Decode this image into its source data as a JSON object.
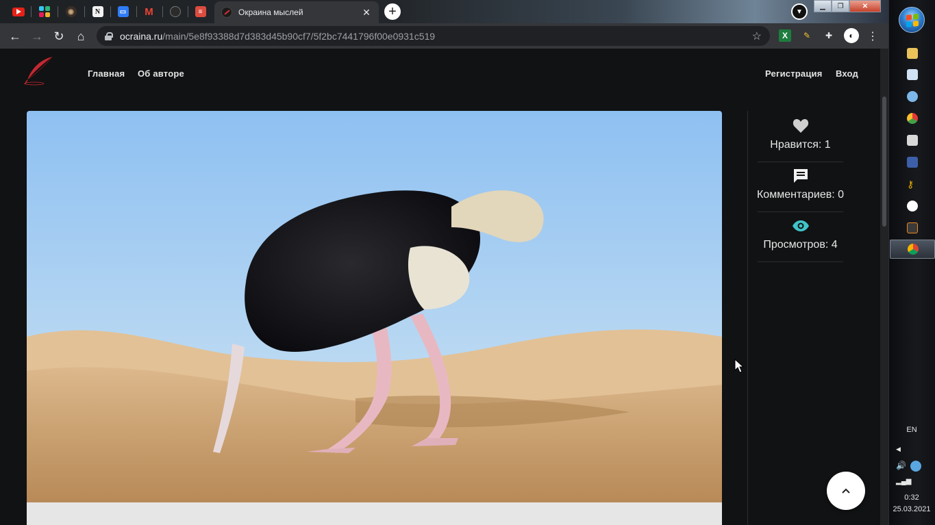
{
  "browser": {
    "active_tab": {
      "title": "Окраина мыслей",
      "close_glyph": "✕"
    },
    "pinned_tabs": [
      "youtube-icon",
      "slack-icon",
      "owl-icon",
      "notion-icon",
      "chat-icon",
      "gmail-icon",
      "github-icon",
      "todoist-icon"
    ],
    "new_tab_glyph": "+",
    "url": {
      "host": "ocraina.ru",
      "path": "/main/5e8f93388d7d383d45b90cf7/5f2bc7441796f00e0931c519"
    },
    "nav": {
      "back": "←",
      "forward": "→",
      "reload": "↻",
      "home": "⌂",
      "star": "☆",
      "menu": "⋮"
    }
  },
  "site": {
    "nav_left": [
      "Главная",
      "Об авторе"
    ],
    "nav_right": [
      "Регистрация",
      "Вход"
    ]
  },
  "stats": {
    "likes": "Нравится: 1",
    "comments": "Комментариев: 0",
    "views": "Просмотров: 4"
  },
  "colors": {
    "page_bg": "#111213",
    "views_icon": "#40c4c8",
    "stat_icon": "#cfcfcf",
    "logo_red": "#c62832"
  },
  "taskbar": {
    "lang": "EN",
    "time": "0:32",
    "date": "25.03.2021"
  }
}
